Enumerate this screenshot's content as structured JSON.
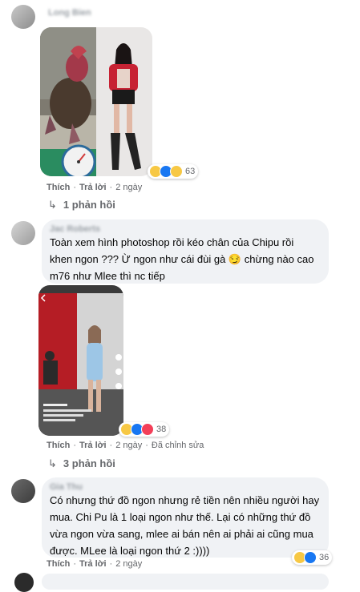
{
  "comments": [
    {
      "author": "Long Bien",
      "actions": {
        "like": "Thích",
        "reply": "Trả lời",
        "time": "2 ngày"
      },
      "reaction_count": "63",
      "replies_label": "1 phản hồi"
    },
    {
      "author": "Jac Roberts",
      "text_lines": [
        "Toàn xem hình photoshop rồi kéo chân của Chipu rồi",
        "khen ngon ??? Ừ ngon như cái đùi gà 😏 chừng nào cao",
        "m76 như Mlee thì nc tiếp"
      ],
      "actions": {
        "like": "Thích",
        "reply": "Trả lời",
        "time": "2 ngày",
        "edited": "Đã chỉnh sửa"
      },
      "reaction_count": "38",
      "replies_label": "3 phản hồi"
    },
    {
      "author": "Gia Thu",
      "text_lines": [
        "Có nhưng thứ đồ ngon nhưng rẻ tiền nên nhiều người hay",
        "mua. Chi Pu là 1 loại ngon như thế. Lại có những thứ đồ",
        "vừa ngon vừa sang, mlee ai bán nên ai phải ai cũng mua",
        "được. MLee là loại ngon thứ 2 :))))"
      ],
      "actions": {
        "like": "Thích",
        "reply": "Trả lời",
        "time": "2 ngày"
      },
      "reaction_count": "36"
    }
  ],
  "colors": {
    "bubble": "#f0f2f5",
    "link": "#65676b",
    "like_blue": "#1877f2"
  }
}
